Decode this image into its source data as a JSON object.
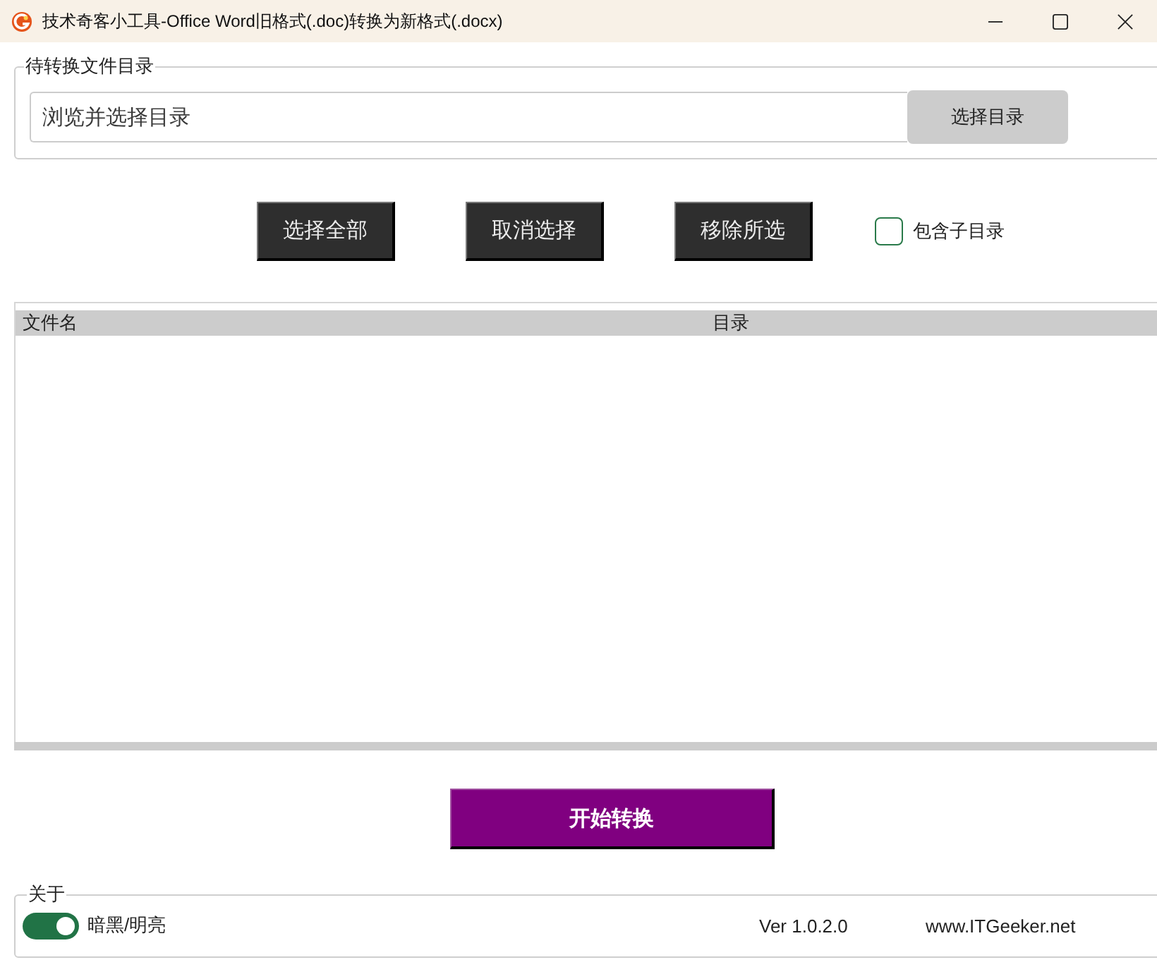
{
  "window": {
    "title": "技术奇客小工具-Office Word旧格式(.doc)转换为新格式(.docx)"
  },
  "source_group": {
    "legend": "待转换文件目录",
    "path_field": {
      "placeholder": "浏览并选择目录"
    },
    "browse_button": "选择目录"
  },
  "actions": {
    "buttons": [
      "选择全部",
      "取消选择",
      "移除所选"
    ],
    "include_subfolders": {
      "label": "包含子目录",
      "checked": false
    }
  },
  "file_table": {
    "columns": [
      "文件名",
      "目录"
    ]
  },
  "start_button": "开始转换",
  "about": {
    "legend": "关于",
    "theme_toggle": {
      "label": "暗黑/明亮",
      "on": true
    },
    "version": "Ver 1.0.2.0",
    "website": "www.ITGeeker.net"
  }
}
